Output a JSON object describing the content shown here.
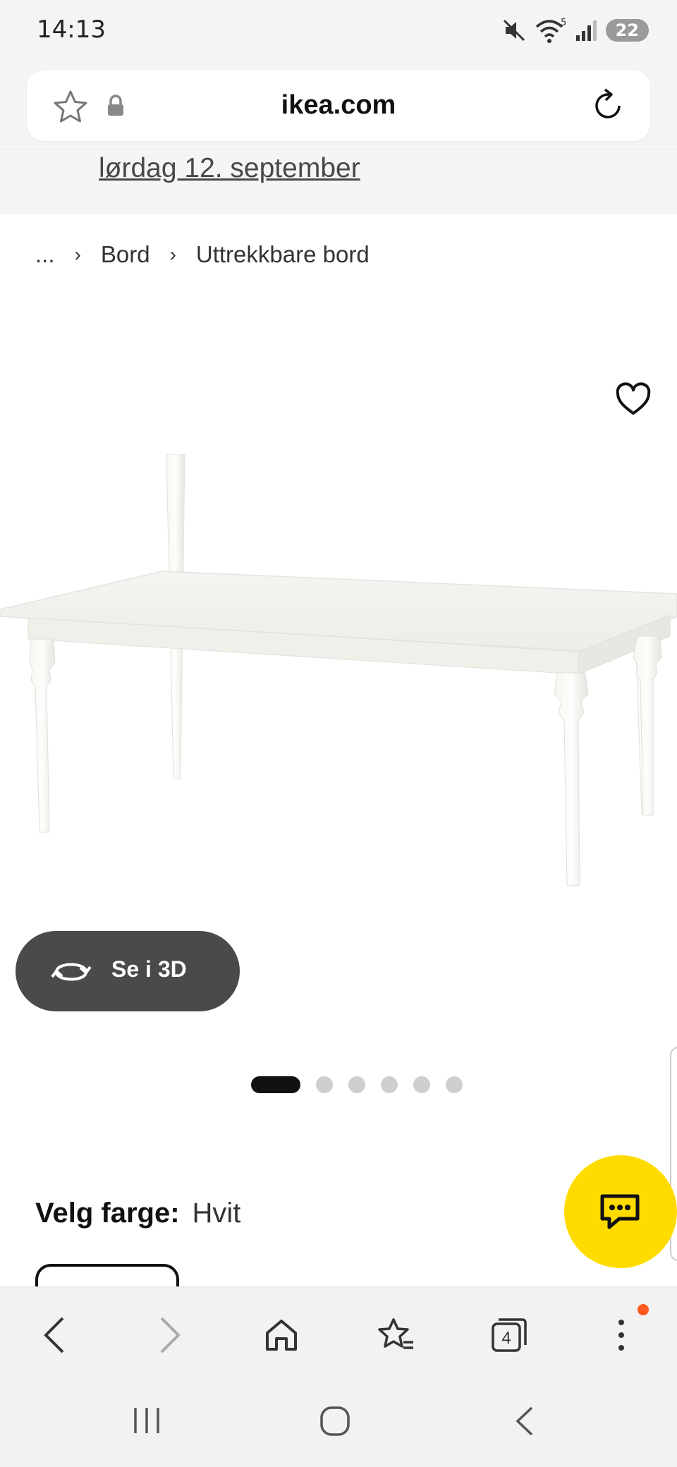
{
  "status": {
    "time": "14:13",
    "network": "5",
    "battery": "22"
  },
  "browser": {
    "url": "ikea.com",
    "tabs_count": "4"
  },
  "delivery": {
    "date_link": "lørdag 12. september"
  },
  "breadcrumb": {
    "ellipsis": "...",
    "items": [
      "Bord",
      "Uttrekkbare bord"
    ]
  },
  "product": {
    "view_3d_label": "Se i 3D",
    "image_count": 6,
    "active_image_index": 0,
    "color_label": "Velg farge:",
    "color_value": "Hvit"
  },
  "icons": {
    "favorite": "heart-icon",
    "rotate": "rotate-3d-icon",
    "chat": "chat-icon",
    "bookmark": "star-icon",
    "secure": "lock-icon",
    "reload": "reload-icon"
  },
  "colors": {
    "chat_button": "#ffdb00",
    "view3d_button": "#4a4a4a",
    "notification": "#ff5a1f"
  }
}
